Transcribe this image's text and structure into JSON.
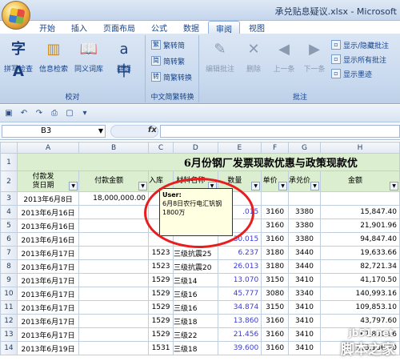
{
  "window": {
    "title": "承兑贴息疑议.xlsx - Microsoft"
  },
  "tabs": [
    "开始",
    "插入",
    "页面布局",
    "公式",
    "数据",
    "审阅",
    "视图"
  ],
  "active_tab": "审阅",
  "ribbon": {
    "proofing": {
      "label": "校对",
      "buttons": [
        "拼写检查",
        "信息检索",
        "同义词库",
        "翻译"
      ]
    },
    "chinese": {
      "label": "中文简繁转换",
      "buttons": [
        "繁转简",
        "简转繁",
        "简繁转换"
      ]
    },
    "comments": {
      "label": "批注",
      "buttons": [
        "编辑批注",
        "删除",
        "上一条",
        "下一条"
      ],
      "options": [
        "显示/隐藏批注",
        "显示所有批注",
        "显示墨迹"
      ]
    }
  },
  "namebox": "B3",
  "fx_label": "fx",
  "columns": [
    "A",
    "B",
    "C",
    "D",
    "E",
    "F",
    "G",
    "H"
  ],
  "sheet_title": "6月份钢厂发票现款优惠与政策现款优",
  "headers": [
    "付款发\n货日期",
    "付款金额",
    "入库",
    "材料名称",
    "数量",
    "单价",
    "承兑价",
    "金额"
  ],
  "rows": [
    {
      "n": "3",
      "a": "2013年6月8日",
      "b": "18,000,000.00",
      "c": "",
      "d": "",
      "e": "",
      "f": "",
      "g": "",
      "h": ""
    },
    {
      "n": "4",
      "a": "2013年6月16日",
      "b": "",
      "c": "",
      "d": "",
      "e": ".015",
      "f": "3160",
      "g": "3380",
      "h": "15,847.40"
    },
    {
      "n": "5",
      "a": "2013年6月16日",
      "b": "",
      "c": "",
      "d": "",
      "e": "",
      "f": "3160",
      "g": "3380",
      "h": "21,901.96"
    },
    {
      "n": "6",
      "a": "2013年6月16日",
      "b": "",
      "c": "",
      "d": "",
      "e": "30.015",
      "f": "3160",
      "g": "3380",
      "h": "94,847.40"
    },
    {
      "n": "7",
      "a": "2013年6月17日",
      "b": "",
      "c": "1523",
      "d": "三级抗震25",
      "e": "6.237",
      "f": "3180",
      "g": "3440",
      "h": "19,633.66"
    },
    {
      "n": "8",
      "a": "2013年6月17日",
      "b": "",
      "c": "1523",
      "d": "三级抗震20",
      "e": "26.013",
      "f": "3180",
      "g": "3440",
      "h": "82,721.34"
    },
    {
      "n": "9",
      "a": "2013年6月17日",
      "b": "",
      "c": "1529",
      "d": "三级14",
      "e": "13.070",
      "f": "3150",
      "g": "3410",
      "h": "41,170.50"
    },
    {
      "n": "10",
      "a": "2013年6月17日",
      "b": "",
      "c": "1529",
      "d": "三级16",
      "e": "45.777",
      "f": "3080",
      "g": "3340",
      "h": "140,993.16"
    },
    {
      "n": "11",
      "a": "2013年6月17日",
      "b": "",
      "c": "1529",
      "d": "三级16",
      "e": "34.874",
      "f": "3150",
      "g": "3410",
      "h": "109,853.10"
    },
    {
      "n": "12",
      "a": "2013年6月17日",
      "b": "",
      "c": "1529",
      "d": "三级18",
      "e": "13.860",
      "f": "3160",
      "g": "3410",
      "h": "43,797.60"
    },
    {
      "n": "13",
      "a": "2013年6月17日",
      "b": "",
      "c": "1529",
      "d": "三级22",
      "e": "21.456",
      "f": "3160",
      "g": "3410",
      "h": "67,800.96"
    },
    {
      "n": "14",
      "a": "2013年6月19日",
      "b": "",
      "c": "1531",
      "d": "三级18",
      "e": "39.600",
      "f": "3160",
      "g": "3410",
      "h": "125,136.00"
    }
  ],
  "comment": {
    "author": "User:",
    "text": "6月8日农行电汇钒钢1800万"
  },
  "watermark": {
    "site": "jb51.net",
    "name": "脚本之家"
  }
}
